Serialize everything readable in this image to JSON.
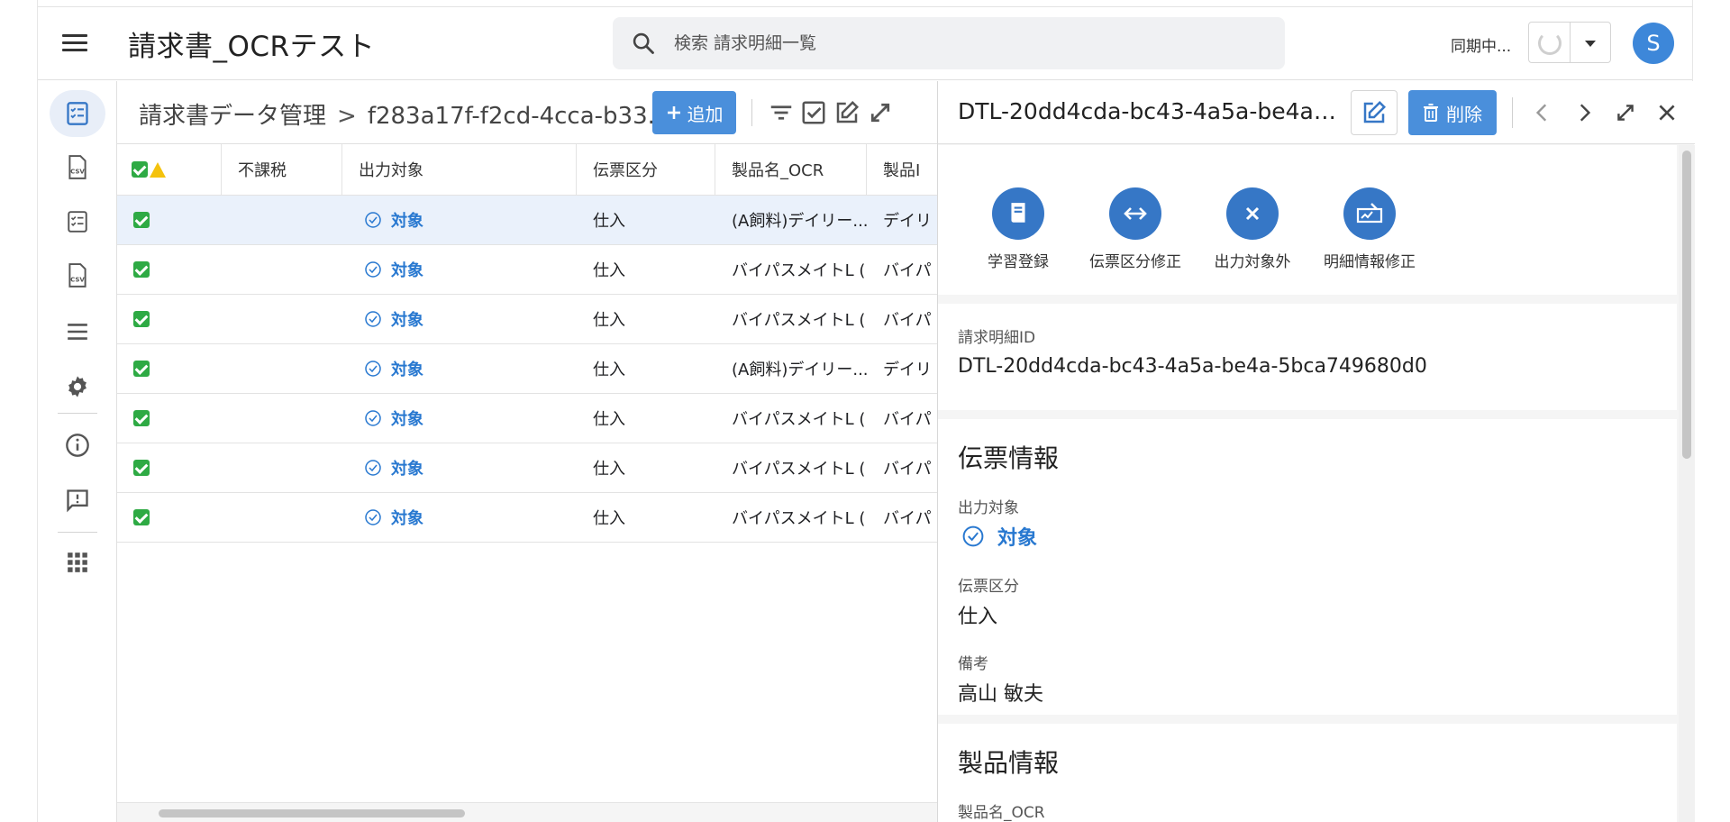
{
  "header": {
    "app_title": "請求書_OCRテスト",
    "search_placeholder": "検索 請求明細一覧",
    "sync_status": "同期中...",
    "avatar_letter": "S"
  },
  "colors": {
    "accent": "#4a8fdb",
    "action_circle": "#3677c6",
    "target_text": "#2878d0",
    "check_green": "#2eaa44"
  },
  "rail": {
    "items": [
      "list-check-icon",
      "csv-file-icon",
      "checklist-icon",
      "csv-file-icon",
      "menu-lines-icon",
      "settings-gear-icon",
      "info-icon",
      "feedback-icon",
      "apps-grid-icon"
    ]
  },
  "list": {
    "breadcrumb_root": "請求書データ管理",
    "breadcrumb_id": "f283a17f-f2cd-4cca-b33...",
    "add_label": "追加",
    "columns": [
      "不課税",
      "出力対象",
      "伝票区分",
      "製品名_OCR",
      "製品I"
    ],
    "rows": [
      {
        "output": "対象",
        "type": "仕入",
        "product_ocr": "(A飼料)デイリー...",
        "product": "デイリ"
      },
      {
        "output": "対象",
        "type": "仕入",
        "product_ocr": "バイパスメイトL (...",
        "product": "バイパ"
      },
      {
        "output": "対象",
        "type": "仕入",
        "product_ocr": "バイパスメイトL (...",
        "product": "バイパ"
      },
      {
        "output": "対象",
        "type": "仕入",
        "product_ocr": "(A飼料)デイリー...",
        "product": "デイリ"
      },
      {
        "output": "対象",
        "type": "仕入",
        "product_ocr": "バイパスメイトL (...",
        "product": "バイパ"
      },
      {
        "output": "対象",
        "type": "仕入",
        "product_ocr": "バイパスメイトL (...",
        "product": "バイパ"
      },
      {
        "output": "対象",
        "type": "仕入",
        "product_ocr": "バイパスメイトL (...",
        "product": "バイパ"
      }
    ]
  },
  "detail": {
    "title": "DTL-20dd4cda-bc43-4a5a-be4a-5b...",
    "delete_label": "削除",
    "actions": [
      "学習登録",
      "伝票区分修正",
      "出力対象外",
      "明細情報修正"
    ],
    "id_label": "請求明細ID",
    "id_value": "DTL-20dd4cda-bc43-4a5a-be4a-5bca749680d0",
    "slip_section": "伝票情報",
    "output_label": "出力対象",
    "output_value": "対象",
    "type_label": "伝票区分",
    "type_value": "仕入",
    "note_label": "備考",
    "note_value": "高山 敏夫",
    "product_section": "製品情報",
    "product_ocr_label": "製品名_OCR"
  }
}
